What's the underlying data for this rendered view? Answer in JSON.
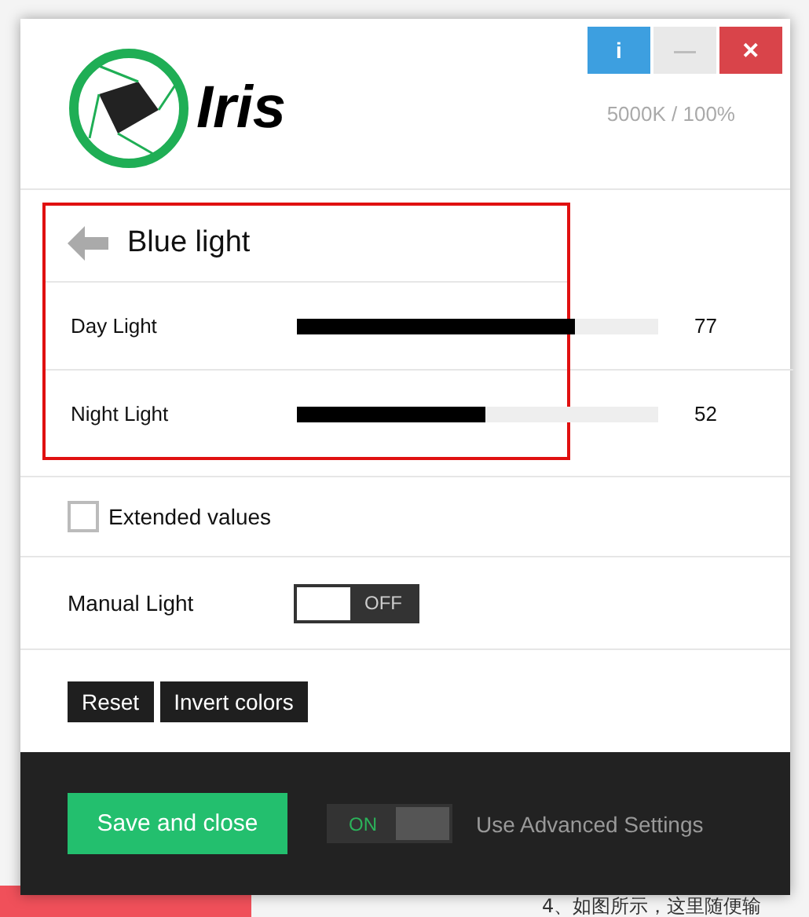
{
  "background": {
    "footer_text": "4、如图所示，这里随便输"
  },
  "window": {
    "buttons": [
      {
        "kind": "info",
        "label": "i"
      },
      {
        "kind": "minimize",
        "label": "—"
      },
      {
        "kind": "close",
        "label": "✕"
      }
    ],
    "logo_text": "Iris",
    "status": "5000K / 100%"
  },
  "panel": {
    "title": "Blue light",
    "highlighted": true,
    "sliders": [
      {
        "name": "Day Light",
        "level": 0.77,
        "reading": "77"
      },
      {
        "name": "Night Light",
        "level": 0.52,
        "reading": "52"
      }
    ]
  },
  "extended_values": {
    "label": "Extended values",
    "checked": false
  },
  "manual_light": {
    "label": "Manual Light",
    "on": false,
    "text": "OFF"
  },
  "actions": [
    "Reset",
    "Invert colors"
  ],
  "footer": {
    "save_button": "Save and close",
    "advanced": {
      "on": true,
      "text": "ON",
      "label": "Use Advanced Settings"
    }
  }
}
